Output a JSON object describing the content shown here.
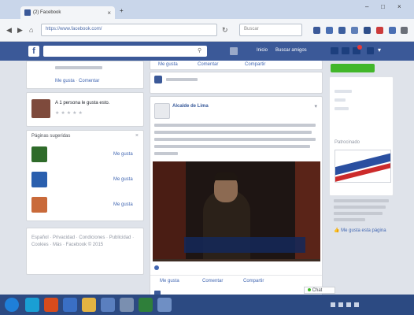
{
  "browser": {
    "tab_title": "(2) Facebook",
    "tab_close": "×",
    "new_tab": "+",
    "controls": {
      "minimize": "–",
      "maximize": "□",
      "close": "×"
    },
    "url": "https://www.facebook.com/",
    "search_placeholder": "Buscar"
  },
  "facebook": {
    "logo": "f",
    "search_value": "",
    "nav": {
      "profile": "",
      "home": "Inicio",
      "find_friends": "Buscar amigos"
    }
  },
  "left": {
    "top_card": {
      "meta": "",
      "actions": [
        "Me gusta",
        "Comentar"
      ]
    },
    "event_card": {
      "text": "A 1 persona le gusta esto."
    },
    "suggestions": {
      "header": "Páginas sugeridas",
      "items": [
        {
          "name": "",
          "like": "Me gusta"
        },
        {
          "name": "",
          "like": "Me gusta"
        },
        {
          "name": "",
          "like": "Me gusta"
        }
      ]
    },
    "footer": "Español · Privacidad · Condiciones · Publicidad · Cookies · Más · Facebook © 2015"
  },
  "feed": {
    "top_actions": [
      "Me gusta",
      "Comentar",
      "Compartir"
    ],
    "small_post_meta": "",
    "post": {
      "author": "Alcalde de Lima",
      "meta": "",
      "text": "",
      "video_caption_name": "",
      "video_caption_sub": "",
      "likes_line": "",
      "actions": [
        "Me gusta",
        "Comentar",
        "Compartir"
      ]
    },
    "chat_label": "Chat"
  },
  "right": {
    "button_label": "",
    "sidebar_label": "",
    "ad_label": "Patrocinado",
    "ad_text": "",
    "ad_link": "Me gusta esta página"
  },
  "taskbar": {
    "time": "",
    "date": ""
  },
  "colors": {
    "facebook_blue": "#3b5998",
    "link_blue": "#4267b2",
    "green": "#42b72a"
  }
}
